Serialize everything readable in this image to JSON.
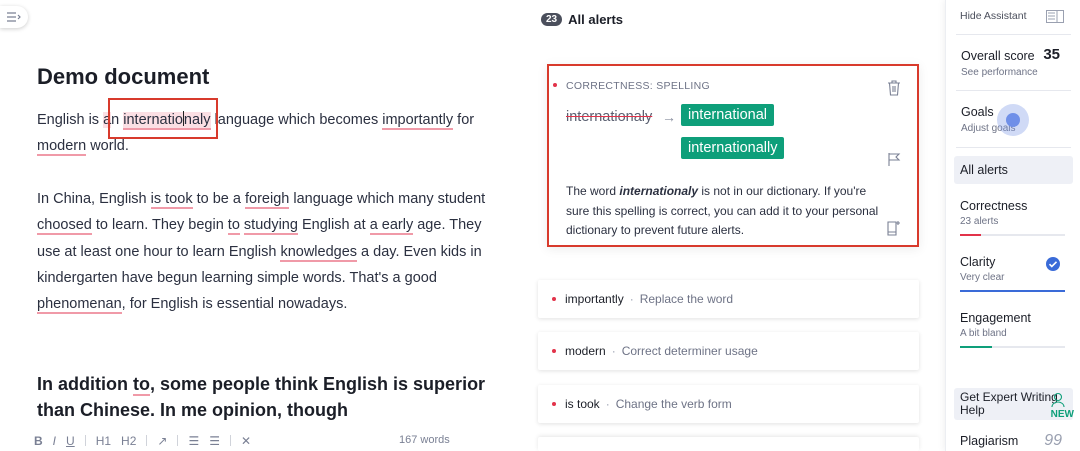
{
  "editor": {
    "title": "Demo document",
    "p1": {
      "a": "English is ",
      "b": "a",
      "c": "n ",
      "d": "internatio",
      "e": "naly",
      "f": " language which becomes ",
      "g": "importantly",
      "h": " for ",
      "i": "modern",
      "j": " world."
    },
    "p2": {
      "s1": "In China, English ",
      "e1": "is took",
      "s2": " to be a ",
      "e2": "foreigh",
      "s3": " language which many student ",
      "e3": "choosed",
      "s4": " to learn. They begin ",
      "e4": "to",
      "s5": " ",
      "e5": "studying",
      "s6": " English at ",
      "e6": "a early",
      "s7": " age. They use at least one hour to learn English ",
      "e7": "knowledges",
      "s8": " a day. Even kids in kindergarten have begun learning simple words. That's a good ",
      "e8": "phenomenan",
      "s9": ", for English is essential nowadays."
    },
    "heading": {
      "a": "In addition ",
      "b": "to",
      "c": ", some people think English is superior than Chinese. In me opinion, though"
    },
    "toolbar": {
      "bold": "B",
      "italic": "I",
      "underline": "U",
      "h1": "H1",
      "h2": "H2",
      "word_count": "167 words"
    }
  },
  "alerts": {
    "count": "23",
    "title": "All alerts",
    "card": {
      "category": "CORRECTNESS: SPELLING",
      "original": "internationaly",
      "suggestion1": "international",
      "suggestion2": "internationally",
      "text_a": "The word ",
      "text_b": "internationaly",
      "text_c": " is not in our dictionary. If you're sure this spelling is correct, you can add it to your personal dictionary to prevent future alerts."
    },
    "items": [
      {
        "word": "importantly",
        "desc": "Replace the word"
      },
      {
        "word": "modern",
        "desc": "Correct determiner usage"
      },
      {
        "word": "is took",
        "desc": "Change the verb form"
      }
    ]
  },
  "sidebar": {
    "hide_assistant": "Hide Assistant",
    "overall_score_label": "Overall score",
    "overall_score": "35",
    "see_performance": "See performance",
    "goals": "Goals",
    "adjust_goals": "Adjust goals",
    "all_alerts": "All alerts",
    "correctness": "Correctness",
    "correctness_sub": "23 alerts",
    "clarity": "Clarity",
    "clarity_sub": "Very clear",
    "engagement": "Engagement",
    "engagement_sub": "A bit bland",
    "expert": "Get Expert Writing Help",
    "new_tag": "NEW",
    "plagiarism": "Plagiarism",
    "colors": {
      "correctness": "#e2334a",
      "clarity": "#3a6bd8",
      "engagement": "#0e9f7a"
    },
    "levels": {
      "correctness": 0.2,
      "clarity": 1.0,
      "engagement": 0.3
    }
  }
}
